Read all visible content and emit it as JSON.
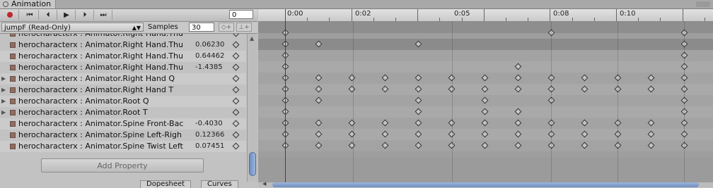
{
  "window": {
    "tab_title": "Animation"
  },
  "toolbar": {
    "frame": "0"
  },
  "clip": {
    "name": "jumpF (Read-Only)"
  },
  "samples": {
    "label": "Samples",
    "value": "30"
  },
  "properties": [
    {
      "name": "herocharacterx : Animator.Right Hand.Thu",
      "value": "0.06230",
      "has_toggle": false
    },
    {
      "name": "herocharacterx : Animator.Right Hand.Thu",
      "value": "0.64462",
      "has_toggle": false
    },
    {
      "name": "herocharacterx : Animator.Right Hand.Thu",
      "value": "-1.4385",
      "has_toggle": false
    },
    {
      "name": "herocharacterx : Animator.Right Hand Q",
      "value": "",
      "has_toggle": true
    },
    {
      "name": "herocharacterx : Animator.Right Hand T",
      "value": "",
      "has_toggle": true
    },
    {
      "name": "herocharacterx : Animator.Root Q",
      "value": "",
      "has_toggle": true
    },
    {
      "name": "herocharacterx : Animator.Root T",
      "value": "",
      "has_toggle": true
    },
    {
      "name": "herocharacterx : Animator.Spine Front-Bac",
      "value": "-0.4030",
      "has_toggle": false
    },
    {
      "name": "herocharacterx : Animator.Spine Left-Righ",
      "value": "0.12366",
      "has_toggle": false
    },
    {
      "name": "herocharacterx : Animator.Spine Twist Left",
      "value": "0.07451",
      "has_toggle": false
    }
  ],
  "partial_row": {
    "name": "herocharacterx : Animator.Right Hand.Thu"
  },
  "buttons": {
    "add_property": "Add Property"
  },
  "bottom_tabs": [
    "Dopesheet",
    "Curves"
  ],
  "timeline": {
    "labels": [
      "0:00",
      "0:02",
      "0:05",
      "0:08",
      "0:10"
    ],
    "playhead_time": "0:00",
    "summary_key_columns": [
      0,
      8,
      12
    ],
    "key_rows": [
      [
        0,
        1,
        4,
        12
      ],
      [
        0,
        12
      ],
      [
        0,
        7,
        12
      ],
      [
        0,
        1,
        2,
        3,
        4,
        5,
        6,
        7,
        8,
        9,
        10,
        11,
        12
      ],
      [
        0,
        1,
        2,
        3,
        4,
        5,
        6,
        7,
        8,
        9,
        10,
        11,
        12
      ],
      [
        0,
        1,
        4,
        6,
        8,
        12
      ],
      [
        0,
        4,
        6,
        7,
        12
      ],
      [
        0,
        1,
        2,
        3,
        4,
        5,
        6,
        7,
        8,
        9,
        10,
        11,
        12
      ],
      [
        0,
        1,
        2,
        3,
        4,
        5,
        6,
        7,
        8,
        9,
        10,
        11,
        12
      ],
      [
        0,
        1,
        2,
        3,
        4,
        5,
        6,
        7,
        8,
        9,
        10,
        11,
        12
      ]
    ],
    "selected_row": 0
  }
}
